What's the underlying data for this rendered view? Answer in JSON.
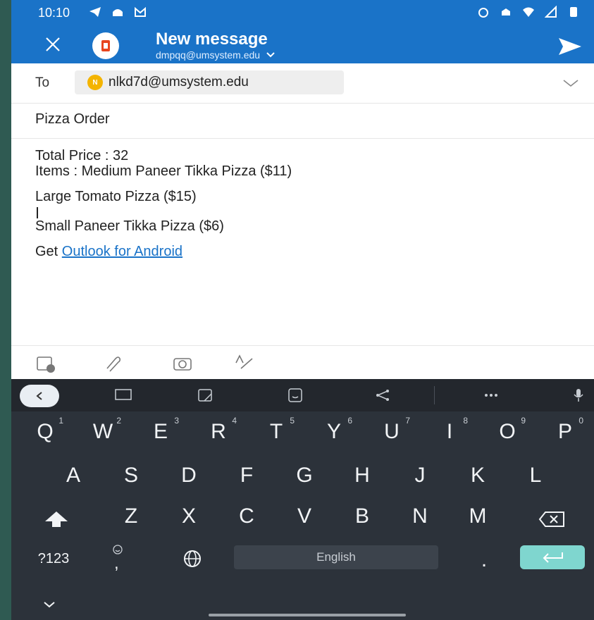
{
  "status_bar": {
    "time": "10:10"
  },
  "header": {
    "title": "New message",
    "account": "dmpqq@umsystem.edu"
  },
  "compose": {
    "to_label": "To",
    "recipient_initial": "N",
    "recipient_email": "nlkd7d@umsystem.edu",
    "subject": "Pizza Order",
    "body": {
      "line1": "Total Price : 32",
      "line2": "Items : Medium Paneer Tikka Pizza ($11)",
      "line3": "Large Tomato Pizza ($15)",
      "line4": "Small Paneer Tikka Pizza ($6)",
      "signature_prefix": "Get ",
      "signature_link": "Outlook for Android"
    }
  },
  "keyboard": {
    "row1": [
      "Q",
      "W",
      "E",
      "R",
      "T",
      "Y",
      "U",
      "I",
      "O",
      "P"
    ],
    "row1_numbers": [
      "1",
      "2",
      "3",
      "4",
      "5",
      "6",
      "7",
      "8",
      "9",
      "0"
    ],
    "row2": [
      "A",
      "S",
      "D",
      "F",
      "G",
      "H",
      "J",
      "K",
      "L"
    ],
    "row3": [
      "Z",
      "X",
      "C",
      "V",
      "B",
      "N",
      "M"
    ],
    "symbols_key": "?123",
    "comma_key": ",",
    "period_key": ".",
    "space_label": "English"
  },
  "colors": {
    "accent": "#1a73c8",
    "keyboard_bg": "#2c323a",
    "enter_key": "#7fd6cf",
    "background": "#2f5a52"
  }
}
